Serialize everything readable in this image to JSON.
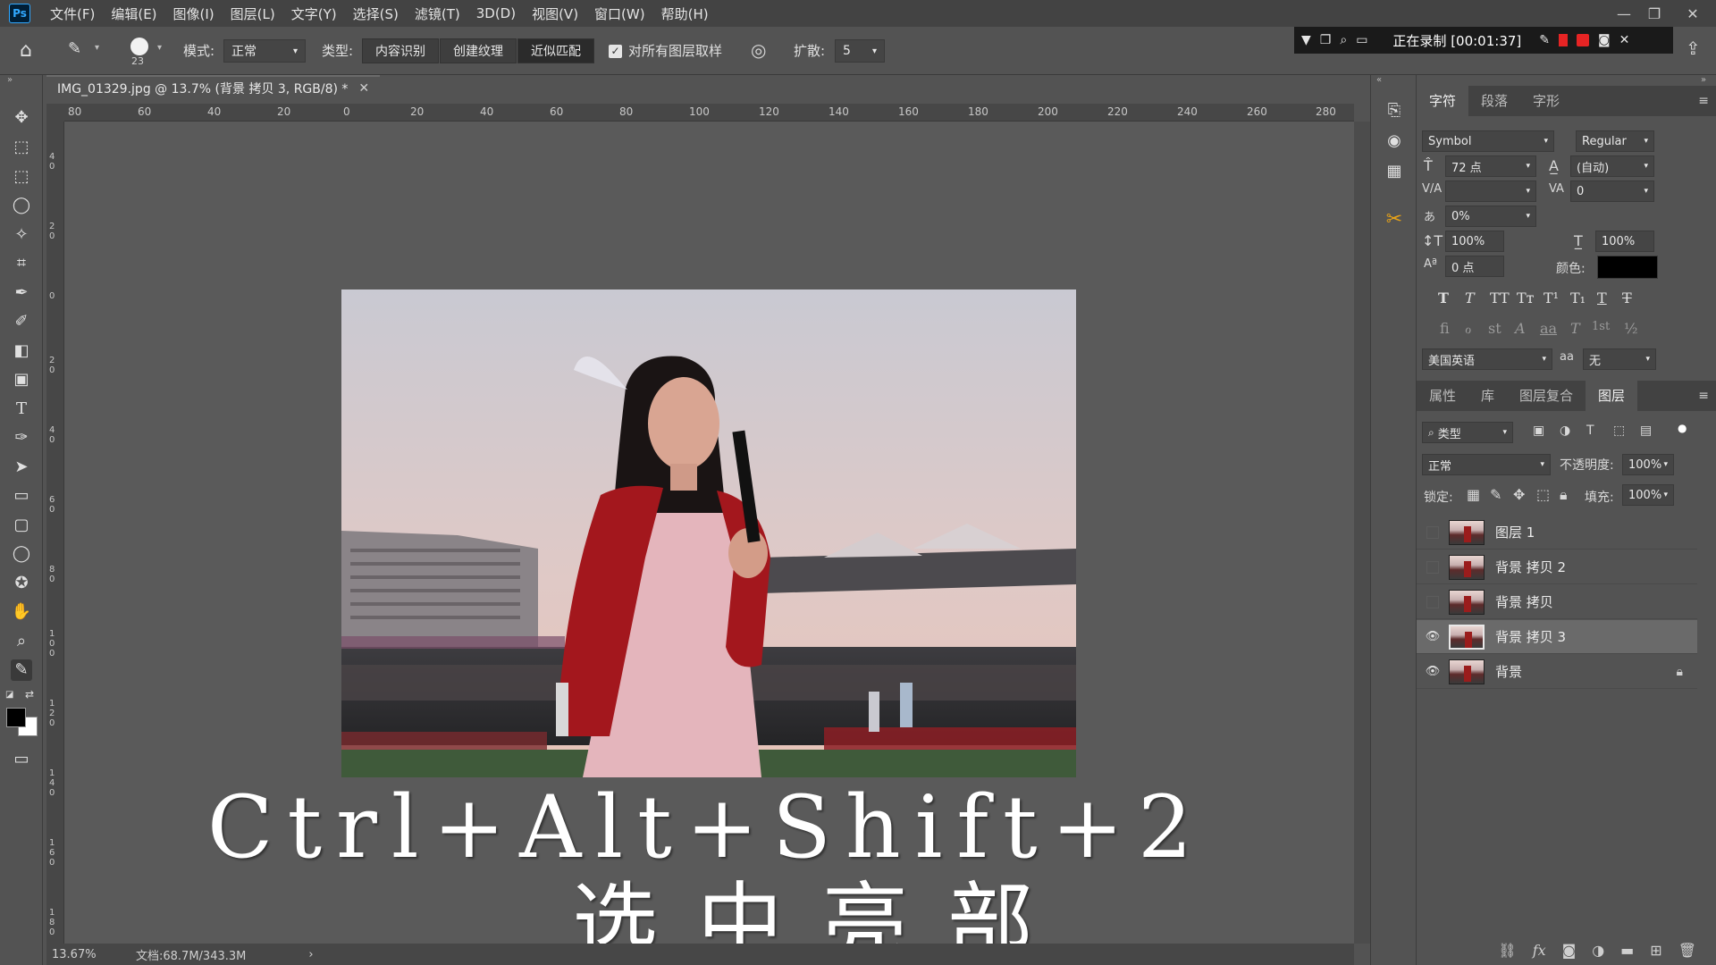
{
  "menu": {
    "logo": "Ps",
    "items": [
      "文件(F)",
      "编辑(E)",
      "图像(I)",
      "图层(L)",
      "文字(Y)",
      "选择(S)",
      "滤镜(T)",
      "3D(D)",
      "视图(V)",
      "窗口(W)",
      "帮助(H)"
    ]
  },
  "recording": {
    "status": "正在录制 [00:01:37]"
  },
  "options": {
    "brush_size": "23",
    "mode_label": "模式:",
    "mode_value": "正常",
    "type_label": "类型:",
    "type_buttons": [
      "内容识别",
      "创建纹理",
      "近似匹配"
    ],
    "sample_all_layers": "对所有图层取样",
    "diffusion_label": "扩散:",
    "diffusion_value": "5"
  },
  "document": {
    "tab_title": "IMG_01329.jpg @ 13.7% (背景 拷贝 3, RGB/8) *",
    "zoom": "13.67%",
    "doc_size": "文档:68.7M/343.3M"
  },
  "rulers": {
    "top": [
      "80",
      "60",
      "40",
      "20",
      "0",
      "20",
      "40",
      "60",
      "80",
      "100",
      "120",
      "140",
      "160",
      "180",
      "200",
      "220",
      "240",
      "260",
      "280"
    ],
    "left": [
      "4 0",
      "2 0",
      "0",
      "2 0",
      "4 0",
      "6 0",
      "8 0",
      "1 0 0",
      "1 2 0",
      "1 4 0",
      "1 6 0",
      "1 8 0"
    ]
  },
  "overlay": {
    "line1": "Ctrl+Alt+Shift+2",
    "line2": "选中亮部"
  },
  "character_panel": {
    "tabs": [
      "字符",
      "段落",
      "字形"
    ],
    "font_family": "Symbol",
    "font_style": "Regular",
    "font_size": "72 点",
    "leading": "(自动)",
    "kerning": "",
    "tracking": "0",
    "tsume": "0%",
    "vertical_scale": "100%",
    "horizontal_scale": "100%",
    "baseline_shift": "0 点",
    "color_label": "颜色:",
    "language": "美国英语",
    "antialias_label": "aa",
    "antialias": "无",
    "style_buttons": [
      "T",
      "T",
      "TT",
      "Tт",
      "T¹",
      "T₁",
      "T",
      "T"
    ],
    "opentype_buttons": [
      "fi",
      "ℴ",
      "st",
      "A",
      "aa",
      "T",
      "1st",
      "½"
    ]
  },
  "layers_panel": {
    "tabs": [
      "属性",
      "库",
      "图层复合",
      "图层"
    ],
    "filter_label": "类型",
    "blend_mode": "正常",
    "opacity_label": "不透明度:",
    "opacity": "100%",
    "lock_label": "锁定:",
    "fill_label": "填充:",
    "fill": "100%",
    "layers": [
      {
        "name": "图层 1",
        "visible": false,
        "selected": false,
        "locked": false
      },
      {
        "name": "背景 拷贝 2",
        "visible": false,
        "selected": false,
        "locked": false
      },
      {
        "name": "背景 拷贝",
        "visible": false,
        "selected": false,
        "locked": false
      },
      {
        "name": "背景 拷贝 3",
        "visible": true,
        "selected": true,
        "locked": false
      },
      {
        "name": "背景",
        "visible": true,
        "selected": false,
        "locked": true
      }
    ]
  }
}
